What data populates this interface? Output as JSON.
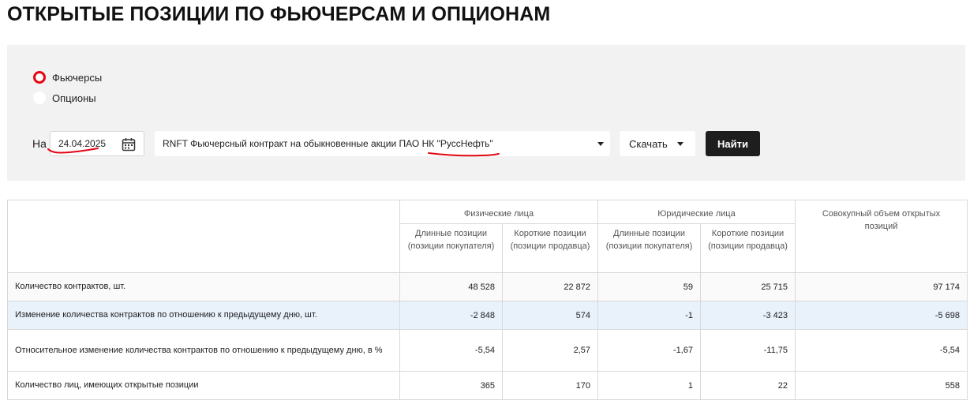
{
  "page": {
    "title": "ОТКРЫТЫЕ ПОЗИЦИИ ПО ФЬЮЧЕРСАМ И ОПЦИОНАМ"
  },
  "filters": {
    "instrument_types": [
      {
        "label": "Фьючерсы",
        "selected": true
      },
      {
        "label": "Опционы",
        "selected": false
      }
    ],
    "date_prefix": "На",
    "date_value": "24.04.2025",
    "instrument": "RNFT Фьючерсный контракт на обыкновенные акции ПАО НК \"РуссНефть\"",
    "download_label": "Скачать",
    "find_label": "Найти"
  },
  "table": {
    "groups": {
      "individuals": "Физические лица",
      "legal": "Юридические лица",
      "total": "Совокупный объем открытых позиций"
    },
    "subheaders": {
      "long": "Длинные позиции (позиции покупателя)",
      "short": "Короткие позиции (позиции продавца)"
    },
    "rows": [
      {
        "label": "Количество контрактов, шт.",
        "values": [
          "48 528",
          "22 872",
          "59",
          "25 715",
          "97 174"
        ]
      },
      {
        "label": "Изменение количества контрактов по отношению к предыдущему дню, шт.",
        "values": [
          "-2 848",
          "574",
          "-1",
          "-3 423",
          "-5 698"
        ]
      },
      {
        "label": "Относительное изменение количества контрактов по отношению к предыдущему дню, в %",
        "values": [
          "-5,54",
          "2,57",
          "-1,67",
          "-11,75",
          "-5,54"
        ]
      },
      {
        "label": "Количество лиц, имеющих открытые позиции",
        "values": [
          "365",
          "170",
          "1",
          "22",
          "558"
        ]
      }
    ]
  },
  "colors": {
    "accent_red": "#e30613",
    "button_dark": "#1e1e1e",
    "panel_bg": "#f2f2f2",
    "row_highlight": "#e9f1fb"
  },
  "icons": {
    "date": "calendar-icon",
    "dropdown": "caret-down-icon"
  }
}
